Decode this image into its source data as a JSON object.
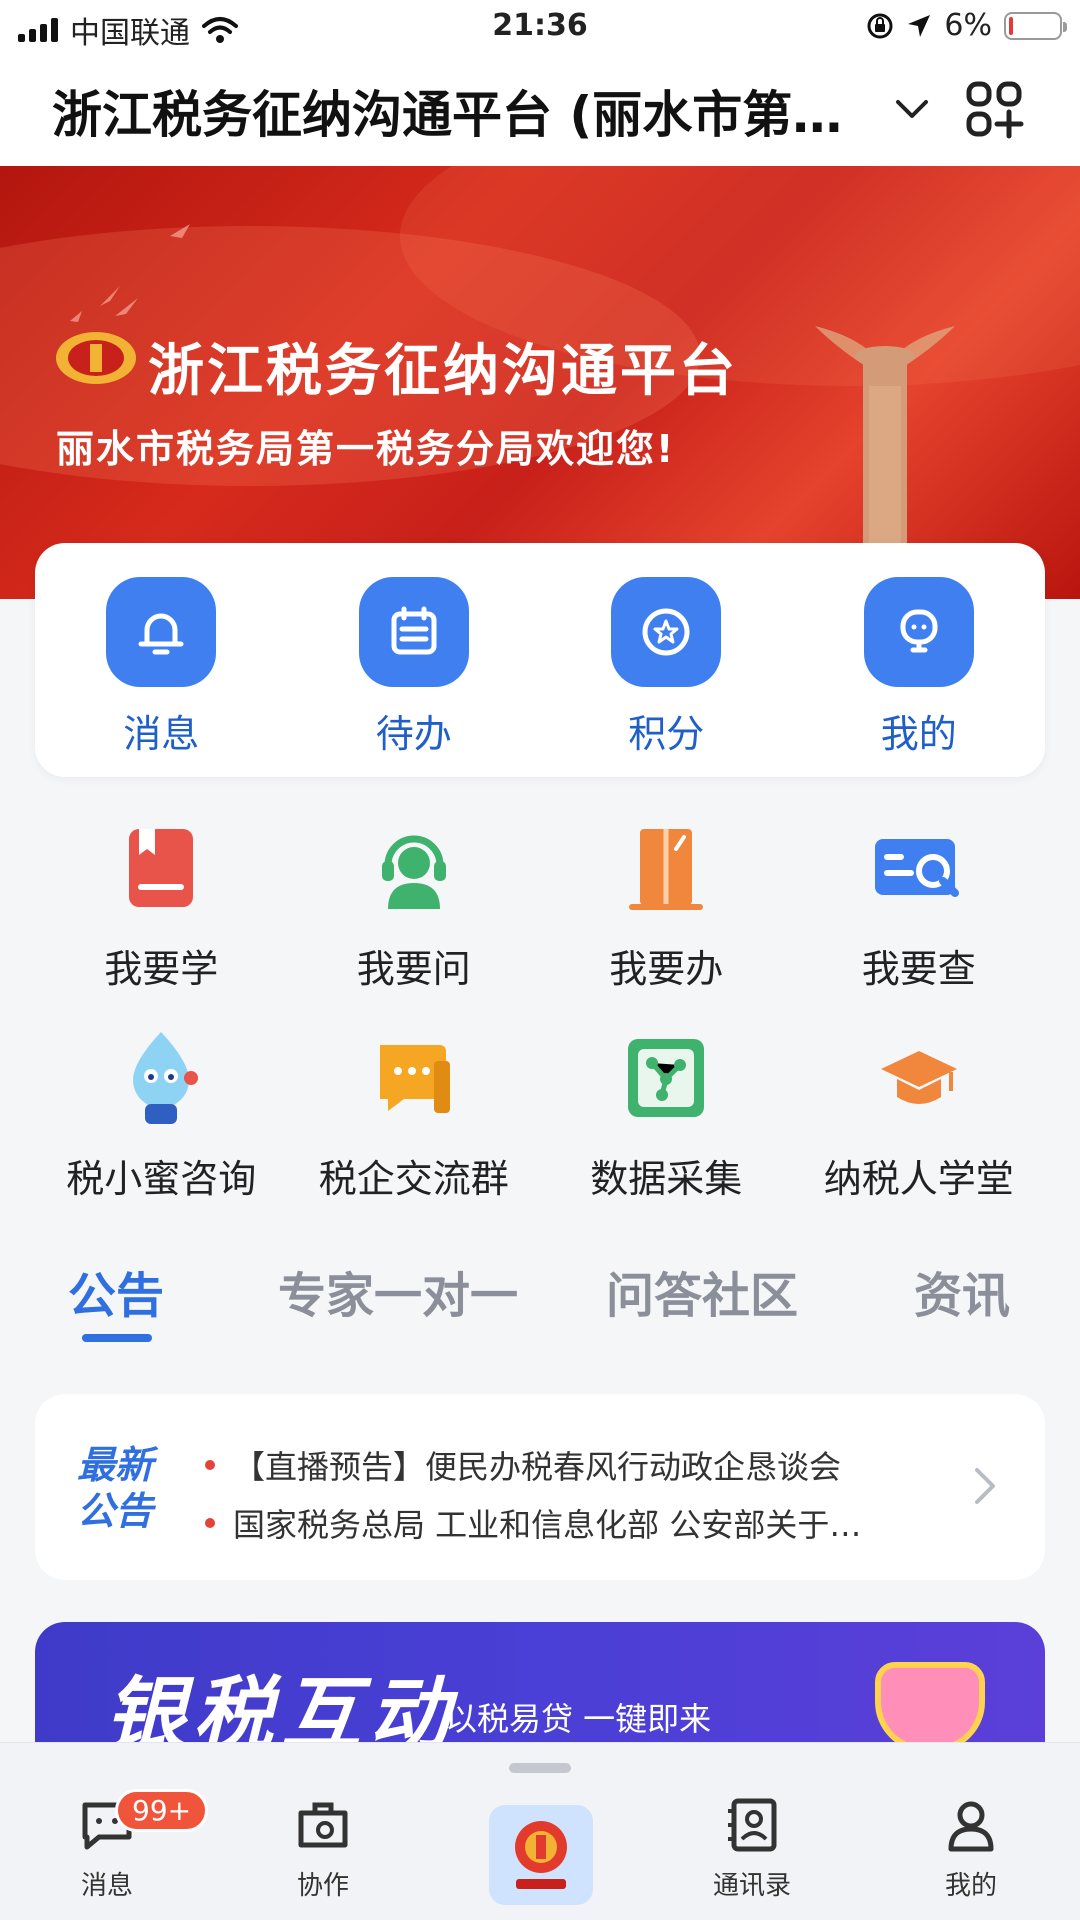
{
  "status_bar": {
    "carrier": "中国联通",
    "time": "21:36",
    "battery": "6%",
    "battery_level": 0.06
  },
  "header": {
    "title": "浙江税务征纳沟通平台 (丽水市第…"
  },
  "banner": {
    "title": "浙江税务征纳沟通平台",
    "subtitle": "丽水市税务局第一税务分局欢迎您!"
  },
  "quick_actions": [
    {
      "label": "消息",
      "icon": "bell-icon"
    },
    {
      "label": "待办",
      "icon": "calendar-icon"
    },
    {
      "label": "积分",
      "icon": "star-icon"
    },
    {
      "label": "我的",
      "icon": "robot-face-icon"
    }
  ],
  "services": [
    {
      "label": "我要学",
      "icon": "book-icon",
      "color": "#e8534a"
    },
    {
      "label": "我要问",
      "icon": "headset-icon",
      "color": "#3fb26d"
    },
    {
      "label": "我要办",
      "icon": "door-icon",
      "color": "#f0873c"
    },
    {
      "label": "我要查",
      "icon": "search-card-icon",
      "color": "#3f7ff0"
    },
    {
      "label": "税小蜜咨询",
      "icon": "mascot-icon",
      "color": "#7ec8f2"
    },
    {
      "label": "税企交流群",
      "icon": "chat-bubble-icon",
      "color": "#f5a623"
    },
    {
      "label": "数据采集",
      "icon": "data-nodes-icon",
      "color": "#3fb26d"
    },
    {
      "label": "纳税人学堂",
      "icon": "graduation-cap-icon",
      "color": "#f0873c"
    }
  ],
  "tabs": [
    {
      "label": "公告",
      "active": true
    },
    {
      "label": "专家一对一",
      "active": false
    },
    {
      "label": "问答社区",
      "active": false
    },
    {
      "label": "资讯",
      "active": false
    }
  ],
  "notice": {
    "badge_line1": "最新",
    "badge_line2": "公告",
    "items": [
      "【直播预告】便民办税春风行动政企恳谈会",
      "国家税务总局 工业和信息化部 公安部关于…"
    ]
  },
  "promo": {
    "title": "银税互动",
    "subtitle": "以税易贷  一键即来"
  },
  "bottom_nav": {
    "items": [
      {
        "label": "消息",
        "icon": "message-icon",
        "badge": "99+"
      },
      {
        "label": "协作",
        "icon": "collaboration-icon"
      },
      {
        "label": "通讯录",
        "icon": "contacts-icon"
      },
      {
        "label": "我的",
        "icon": "person-icon"
      }
    ],
    "center_icon": "tax-emblem-icon"
  }
}
